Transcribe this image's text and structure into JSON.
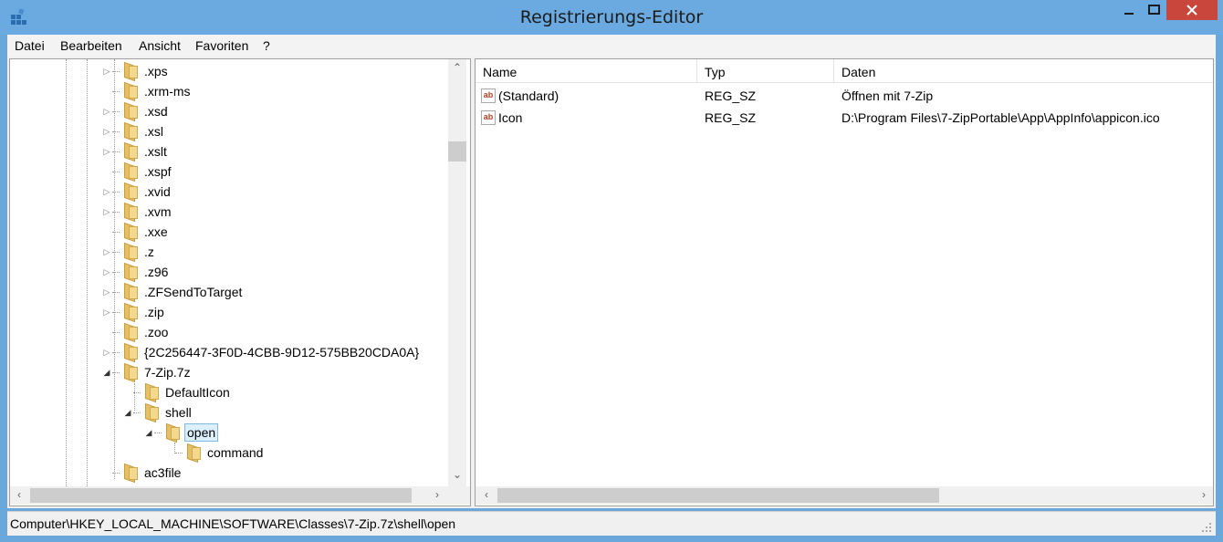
{
  "window": {
    "title": "Registrierungs-Editor"
  },
  "menubar": [
    {
      "label": "Datei",
      "access_key": "D"
    },
    {
      "label": "Bearbeiten",
      "access_key": "B"
    },
    {
      "label": "Ansicht",
      "access_key": "A"
    },
    {
      "label": "Favoriten",
      "access_key": "F"
    },
    {
      "label": "?",
      "access_key": "?"
    }
  ],
  "tree": {
    "items": [
      {
        "label": ".xps",
        "level": 0,
        "state": "collapsed"
      },
      {
        "label": ".xrm-ms",
        "level": 0,
        "state": "leaf"
      },
      {
        "label": ".xsd",
        "level": 0,
        "state": "collapsed"
      },
      {
        "label": ".xsl",
        "level": 0,
        "state": "collapsed"
      },
      {
        "label": ".xslt",
        "level": 0,
        "state": "collapsed"
      },
      {
        "label": ".xspf",
        "level": 0,
        "state": "leaf"
      },
      {
        "label": ".xvid",
        "level": 0,
        "state": "collapsed"
      },
      {
        "label": ".xvm",
        "level": 0,
        "state": "collapsed"
      },
      {
        "label": ".xxe",
        "level": 0,
        "state": "leaf"
      },
      {
        "label": ".z",
        "level": 0,
        "state": "collapsed"
      },
      {
        "label": ".z96",
        "level": 0,
        "state": "collapsed"
      },
      {
        "label": ".ZFSendToTarget",
        "level": 0,
        "state": "collapsed"
      },
      {
        "label": ".zip",
        "level": 0,
        "state": "collapsed"
      },
      {
        "label": ".zoo",
        "level": 0,
        "state": "leaf"
      },
      {
        "label": "{2C256447-3F0D-4CBB-9D12-575BB20CDA0A}",
        "level": 0,
        "state": "collapsed"
      },
      {
        "label": "7-Zip.7z",
        "level": 0,
        "state": "expanded"
      },
      {
        "label": "DefaultIcon",
        "level": 1,
        "state": "leaf"
      },
      {
        "label": "shell",
        "level": 1,
        "state": "expanded"
      },
      {
        "label": "open",
        "level": 2,
        "state": "expanded",
        "selected": true
      },
      {
        "label": "command",
        "level": 3,
        "state": "leaf"
      },
      {
        "label": "ac3file",
        "level": 0,
        "state": "leaf"
      }
    ]
  },
  "values": {
    "columns": [
      "Name",
      "Typ",
      "Daten"
    ],
    "rows": [
      {
        "icon": "string-value-icon",
        "name": "(Standard)",
        "type": "REG_SZ",
        "data": "Öffnen mit 7-Zip"
      },
      {
        "icon": "string-value-icon",
        "name": "Icon",
        "type": "REG_SZ",
        "data": "D:\\Program Files\\7-ZipPortable\\App\\AppInfo\\appicon.ico"
      }
    ]
  },
  "statusbar": {
    "path": "Computer\\HKEY_LOCAL_MACHINE\\SOFTWARE\\Classes\\7-Zip.7z\\shell\\open"
  },
  "colors": {
    "titlebar": "#6aaae0",
    "close_button": "#c9463d",
    "selection": "#dceffc"
  }
}
